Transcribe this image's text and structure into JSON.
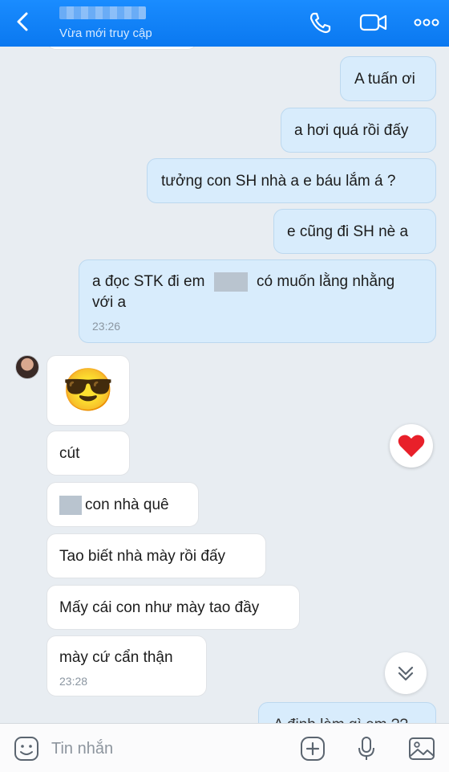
{
  "header": {
    "status": "Vừa mới truy cập",
    "icons": [
      "back-icon",
      "phone-icon",
      "video-icon",
      "more-icon"
    ]
  },
  "messages": {
    "out1": "A tuấn ơi",
    "out2": "a hơi quá rồi đấy",
    "out3": "tưởng con SH nhà a e báu lắm á ?",
    "out4": "e cũng đi SH nè a",
    "out5_part1": "a đọc STK đi em",
    "out5_part2": "có muốn lằng nhằng",
    "out5_part3": "với a",
    "out5_time": "23:26",
    "in_emoji": "😎",
    "in1": "cút",
    "in2": "con nhà quê",
    "in3": "Tao biết nhà mày rồi đấy",
    "in4": "Mấy cái con như mày tao đầy",
    "in5": "mày cứ cẩn thận",
    "in5_time": "23:28",
    "out6_partial": "A định làm gì em ??"
  },
  "reaction": "❤️",
  "composer": {
    "placeholder": "Tin nhắn"
  },
  "colors": {
    "header": "#0a78f0",
    "outgoing_bubble": "#d8ecfc",
    "incoming_bubble": "#ffffff",
    "background": "#e8edf2"
  }
}
